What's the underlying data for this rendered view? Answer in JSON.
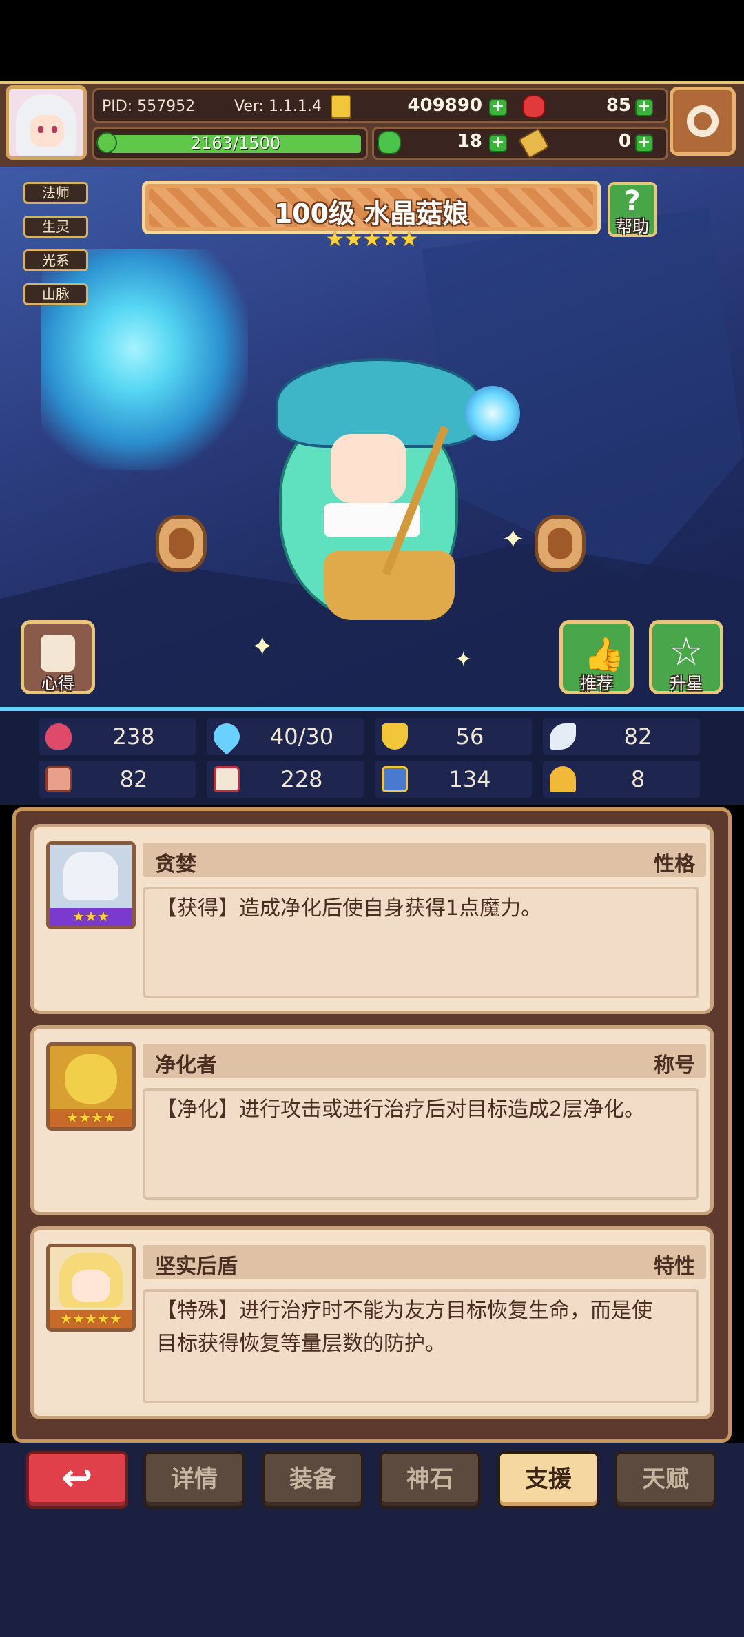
{
  "header": {
    "pid": "PID: 557952",
    "version": "Ver: 1.1.1.4",
    "exp": "2163/1500",
    "exp_progress": 1.0,
    "gold": "409890",
    "gem": "85",
    "clover": "18",
    "key": "0"
  },
  "tags": [
    "法师",
    "生灵",
    "光系",
    "山脉"
  ],
  "hero": {
    "title": "100级  水晶菇娘",
    "stars": 5,
    "star_glyph": "★"
  },
  "buttons": {
    "help": "帮助",
    "notes": "心得",
    "recommend": "推荐",
    "upstar": "升星"
  },
  "stats": [
    {
      "icon": "heart-icon",
      "value": "238"
    },
    {
      "icon": "mana-drop-icon",
      "value": "40/30"
    },
    {
      "icon": "shield-icon",
      "value": "56"
    },
    {
      "icon": "wing-icon",
      "value": "82"
    },
    {
      "icon": "fist-icon",
      "value": "82"
    },
    {
      "icon": "book-icon",
      "value": "228"
    },
    {
      "icon": "scroll-icon",
      "value": "134"
    },
    {
      "icon": "horseshoe-icon",
      "value": "8"
    }
  ],
  "cards": [
    {
      "name": "贪婪",
      "kind": "性格",
      "stars": "★★★",
      "desc": "【获得】造成净化后使自身获得1点魔力。"
    },
    {
      "name": "净化者",
      "kind": "称号",
      "stars": "★★★★",
      "desc": "【净化】进行攻击或进行治疗后对目标造成2层净化。"
    },
    {
      "name": "坚实后盾",
      "kind": "特性",
      "stars": "★★★★★",
      "desc_line1": "【特殊】进行治疗时不能为友方目标恢复生命，而是使",
      "desc_line2": "目标获得恢复等量层数的防护。"
    }
  ],
  "nav": {
    "back": "↩",
    "items": [
      "详情",
      "装备",
      "神石",
      "支援",
      "天赋"
    ],
    "active": "支援"
  }
}
